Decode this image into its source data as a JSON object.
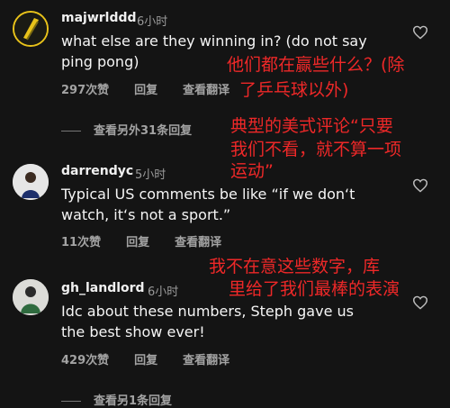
{
  "comments": [
    {
      "username": "majwrlddd",
      "time": "6小时",
      "text_line1": "what else are they winning in? (do not say",
      "text_line2": "ping pong)",
      "likes": "297次赞",
      "reply": "回复",
      "translate": "查看翻译",
      "more_replies": "查看另外31条回复",
      "annotation_line1": "他们都在赢些什么？(除",
      "annotation_line2": "了乒乓球以外)"
    },
    {
      "username": "darrendyc",
      "time": "5小时",
      "text_line1": "Typical US comments be like “if we don‘t",
      "text_line2": "watch, it‘s not a sport.”",
      "likes": "11次赞",
      "reply": "回复",
      "translate": "查看翻译",
      "annotation_line1": "典型的美式评论“只要",
      "annotation_line2": "我们不看，就不算一项",
      "annotation_line3": "运动”"
    },
    {
      "username": "gh_landlord",
      "time": "6小时",
      "text_line1": "Idc about these numbers, Steph gave us",
      "text_line2": "the best show ever!",
      "likes": "429次赞",
      "reply": "回复",
      "translate": "查看翻译",
      "more_replies": "查看另1条回复",
      "annotation_line1": "我不在意这些数字，库",
      "annotation_line2": "里给了我们最棒的表演"
    }
  ],
  "colors": {
    "background": "#141414",
    "annotation": "#ff2a2a",
    "secondary_text": "#a3a3a3"
  }
}
